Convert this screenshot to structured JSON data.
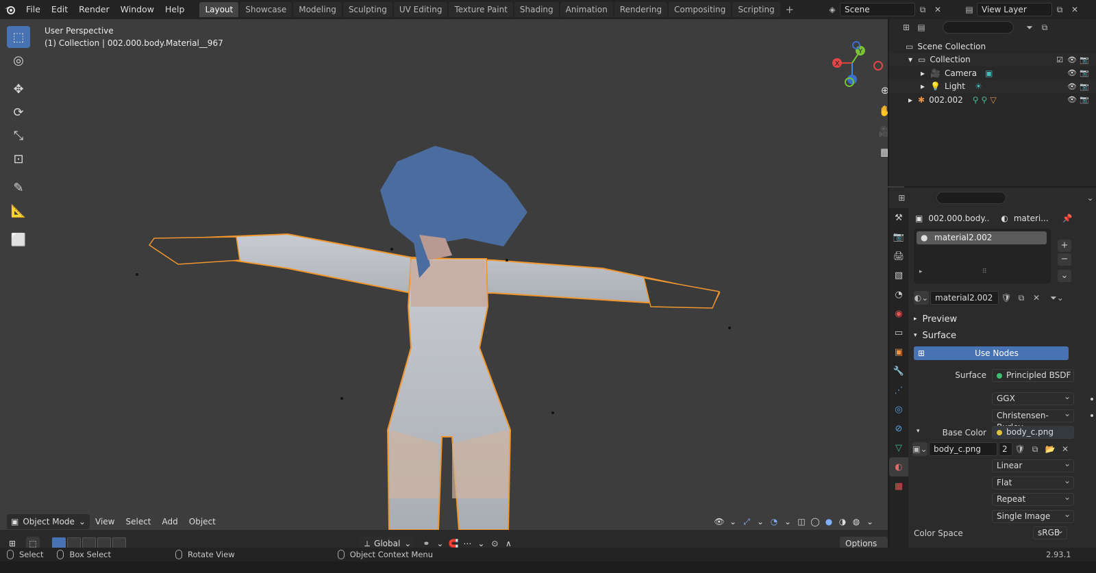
{
  "topbar": {
    "menus": [
      "File",
      "Edit",
      "Render",
      "Window",
      "Help"
    ],
    "workspaces": [
      "Layout",
      "Showcase",
      "Modeling",
      "Sculpting",
      "UV Editing",
      "Texture Paint",
      "Shading",
      "Animation",
      "Rendering",
      "Compositing",
      "Scripting"
    ],
    "active_workspace": "Layout",
    "scene": "Scene",
    "view_layer": "View Layer"
  },
  "viewport": {
    "perspective": "User Perspective",
    "object_info": "(1) Collection | 002.000.body.Material__967",
    "mode": "Object Mode",
    "menus": [
      "View",
      "Select",
      "Add",
      "Object"
    ],
    "orientation": "Global",
    "options": "Options",
    "gizmo": {
      "x": "X",
      "y": "Y"
    }
  },
  "outliner": {
    "rows": [
      {
        "label": "Scene Collection"
      },
      {
        "label": "Collection"
      },
      {
        "label": "Camera"
      },
      {
        "label": "Light"
      },
      {
        "label": "002.002"
      }
    ]
  },
  "properties": {
    "object_name": "002.000.body....",
    "material_crumb": "materi...",
    "slot_name": "material2.002",
    "material_name": "material2.002",
    "sections": {
      "preview": "Preview",
      "surface": "Surface"
    },
    "use_nodes": "Use Nodes",
    "surface_label": "Surface",
    "surface_value": "Principled BSDF",
    "distribution": "GGX",
    "subsurface_method": "Christensen-Burley",
    "base_color_label": "Base Color",
    "base_color_value": "body_c.png",
    "image_name": "body_c.png",
    "image_users": "2",
    "interpolation": "Linear",
    "projection": "Flat",
    "extension": "Repeat",
    "source": "Single Image",
    "color_space_label": "Color Space",
    "color_space": "sRGB"
  },
  "statusbar": {
    "select": "Select",
    "box_select": "Box Select",
    "rotate_view": "Rotate View",
    "context_menu": "Object Context Menu",
    "version": "2.93.1"
  },
  "colors": {
    "accent": "#4772b3",
    "selection_outline": "#f0962e",
    "viewport_bg": "#3d3d3d"
  }
}
